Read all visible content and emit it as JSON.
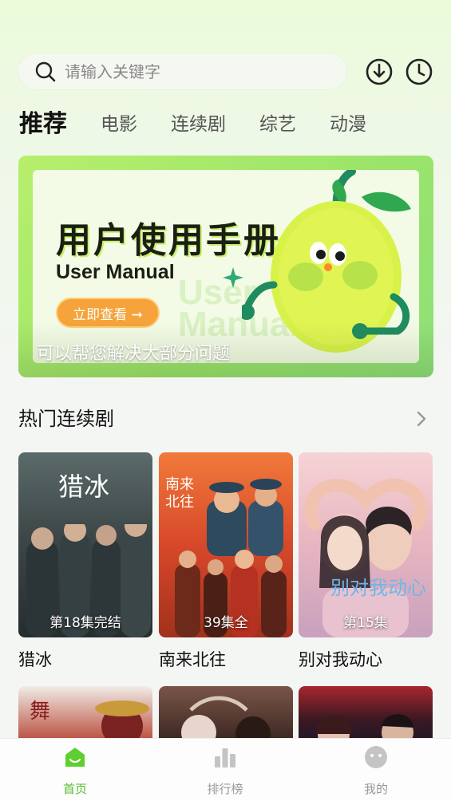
{
  "search": {
    "placeholder": "请输入关键字"
  },
  "header_icons": {
    "download": "download-icon",
    "history": "history-clock-icon"
  },
  "tabs": [
    {
      "label": "推荐",
      "active": true
    },
    {
      "label": "电影",
      "active": false
    },
    {
      "label": "连续剧",
      "active": false
    },
    {
      "label": "综艺",
      "active": false
    },
    {
      "label": "动漫",
      "active": false
    }
  ],
  "banner": {
    "title": "用户使用手册",
    "subtitle_en": "User Manual",
    "button": "立即查看 ➞",
    "watermark": "User Manual",
    "caption": "可以帮您解决大部分问题"
  },
  "section": {
    "title": "热门连续剧",
    "more_icon": "chevron-right-icon"
  },
  "cards": [
    {
      "name": "猎冰",
      "label": "第18集完结",
      "poster_text": "猎冰",
      "color_top": "#3e4a4e",
      "color_bottom": "#232a2c"
    },
    {
      "name": "南来北往",
      "label": "39集全",
      "poster_text": "南来北往",
      "color_top": "#e2522a",
      "color_bottom": "#a3361d"
    },
    {
      "name": "别对我动心",
      "label": "第15集",
      "poster_text": "别对我动心",
      "color_top": "#f1c7cc",
      "color_bottom": "#caa2b6"
    }
  ],
  "row2_colors": [
    "#9a2a2a",
    "#4a2e28",
    "#2b2230"
  ],
  "nav": [
    {
      "label": "首页",
      "icon": "home-icon",
      "active": true
    },
    {
      "label": "排行榜",
      "icon": "bar-chart-icon",
      "active": false
    },
    {
      "label": "我的",
      "icon": "profile-face-icon",
      "active": false
    }
  ],
  "colors": {
    "accent": "#55bb2e",
    "banner_green": "#a6ea6a",
    "button_orange": "#f5a33a"
  }
}
